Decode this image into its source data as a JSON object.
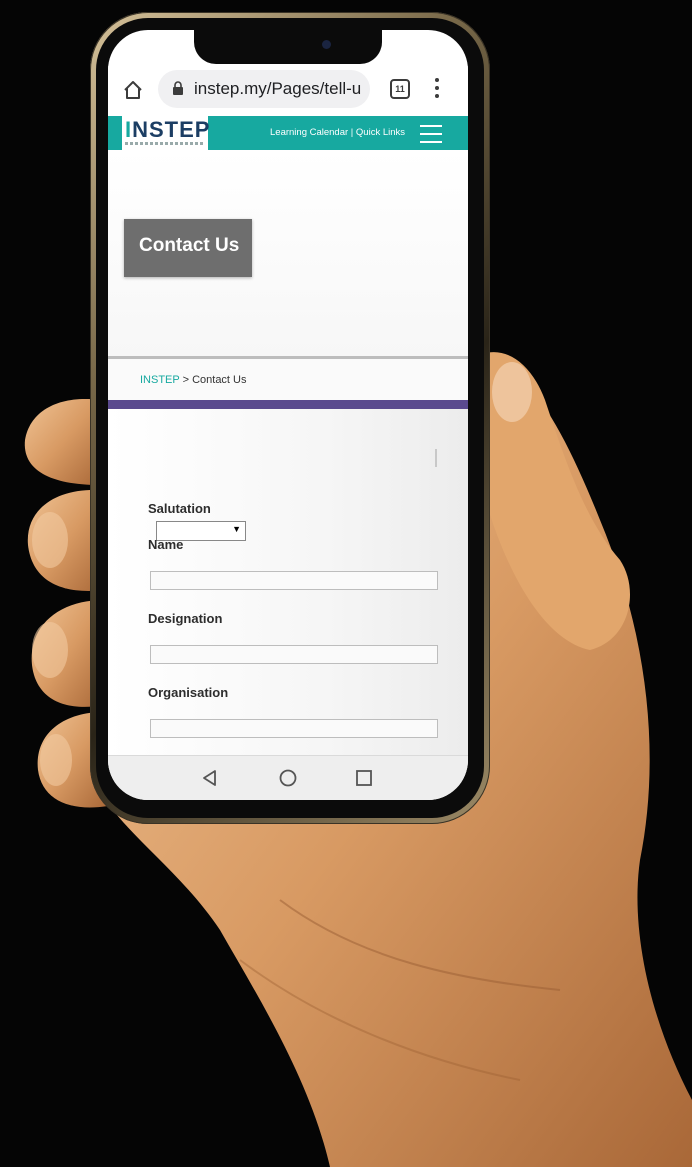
{
  "browser": {
    "url": "instep.my/Pages/tell-u",
    "tab_count": "11"
  },
  "site": {
    "logo": "INSTEP",
    "header_links": "Learning Calendar | Quick Links",
    "colors": {
      "teal": "#17a9a0",
      "navy": "#1c3e64",
      "purple": "#5a4a8e",
      "title_box": "#6e6e6e"
    }
  },
  "hero": {
    "title": "Contact Us"
  },
  "breadcrumb": {
    "home": "INSTEP",
    "separator": " > ",
    "current": "Contact Us"
  },
  "form": {
    "salutation_label": "Salutation",
    "salutation_value": "",
    "name_label": "Name",
    "name_value": "",
    "designation_label": "Designation",
    "designation_value": "",
    "organisation_label": "Organisation",
    "organisation_value": ""
  },
  "icons": {
    "home": "home-icon",
    "lock": "lock-icon",
    "menu": "more-vert-icon",
    "hamburger": "hamburger-icon",
    "nav_back": "nav-back-icon",
    "nav_home": "nav-home-icon",
    "nav_recents": "nav-recents-icon"
  }
}
